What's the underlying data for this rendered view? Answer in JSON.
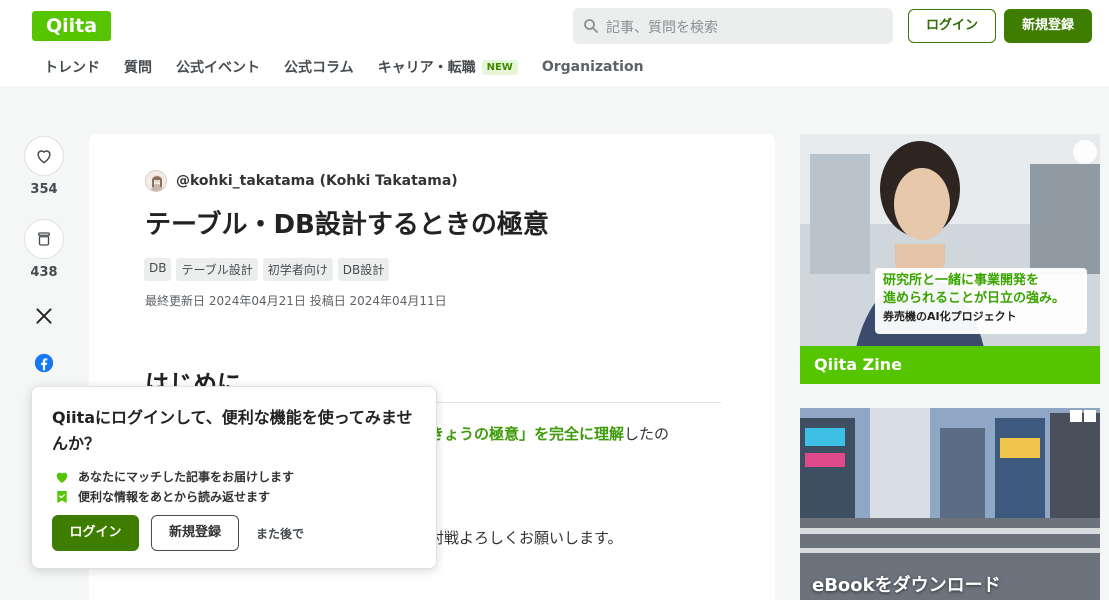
{
  "header": {
    "logo": "Qiita",
    "search_placeholder": "記事、質問を検索",
    "login_label": "ログイン",
    "register_label": "新規登録"
  },
  "nav": {
    "items": [
      {
        "label": "トレンド"
      },
      {
        "label": "質問"
      },
      {
        "label": "公式イベント"
      },
      {
        "label": "公式コラム"
      },
      {
        "label": "キャリア・転職",
        "badge": "NEW"
      },
      {
        "label": "Organization"
      }
    ]
  },
  "actions": {
    "likes": "354",
    "stocks": "438"
  },
  "article": {
    "author": "@kohki_takatama (Kohki Takatama)",
    "title": "テーブル・DB設計するときの極意",
    "tags": [
      "DB",
      "テーブル設計",
      "初学者向け",
      "DB設計"
    ],
    "dates": "最終更新日 2024年04月21日  投稿日 2024年04月11日",
    "heading": "はじめに",
    "line1_highlight": "きょうの極意」を完全に理解",
    "line1_suffix": "したの",
    "line2": "。",
    "line3": "対戦よろしくお願いします。"
  },
  "popup": {
    "title": "Qiitaにログインして、便利な機能を使ってみませんか？",
    "feature1": "あなたにマッチした記事をお届けします",
    "feature2": "便利な情報をあとから読み返せます",
    "login_label": "ログイン",
    "register_label": "新規登録",
    "later_label": "また後で"
  },
  "ads": {
    "ad1": {
      "line1": "研究所と一緒に事業開発を",
      "line2": "進められることが日立の強み。",
      "line3": "券売機のAI化プロジェクト",
      "brand": "Qiita Zine"
    },
    "ad2": {
      "caption": "eBookをダウンロード"
    }
  },
  "colors": {
    "brand_green": "#55c500",
    "button_green": "#3e7d00",
    "link_green": "#3f9b0b"
  }
}
